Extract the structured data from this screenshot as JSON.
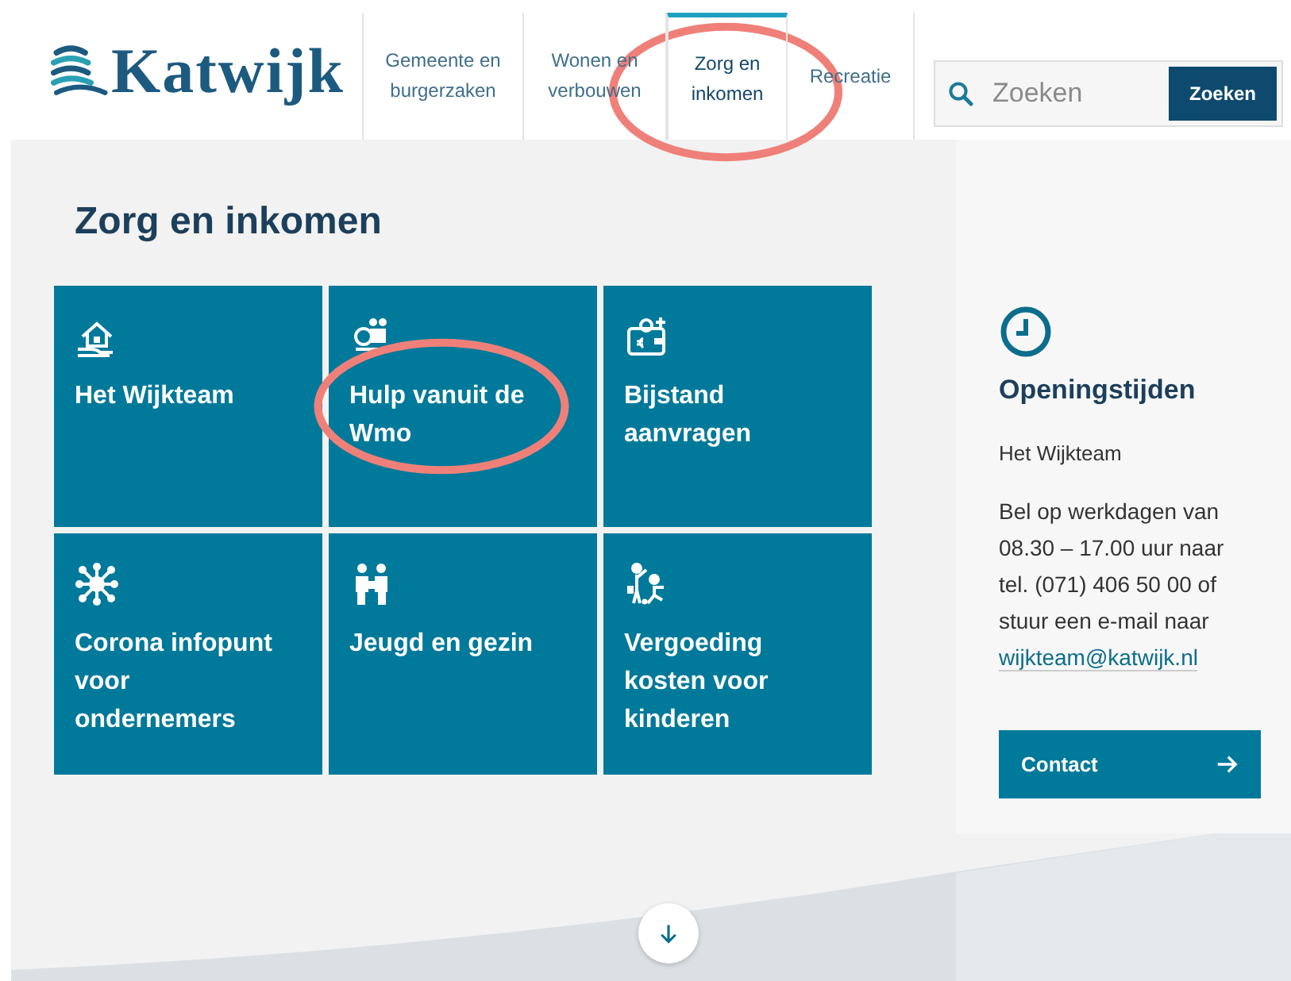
{
  "header": {
    "logo_text": "Katwijk",
    "nav": [
      {
        "label": "Gemeente en burgerzaken",
        "selected": false,
        "circled": false
      },
      {
        "label": "Wonen en verbouwen",
        "selected": false,
        "circled": false
      },
      {
        "label": "Zorg en inkomen",
        "selected": true,
        "circled": true
      },
      {
        "label": "Recreatie",
        "selected": false,
        "circled": false
      }
    ],
    "search": {
      "placeholder": "Zoeken",
      "button": "Zoeken"
    }
  },
  "main": {
    "title": "Zorg en inkomen",
    "tiles": [
      {
        "label": "Het Wijkteam",
        "circled": false
      },
      {
        "label": "Hulp vanuit de Wmo",
        "circled": true
      },
      {
        "label": "Bijstand aanvragen",
        "circled": false
      },
      {
        "label": "Corona infopunt voor ondernemers",
        "circled": false
      },
      {
        "label": "Jeugd en gezin",
        "circled": false
      },
      {
        "label": "Vergoeding kosten voor kinderen",
        "circled": false
      }
    ]
  },
  "sidebar": {
    "heading": "Openingstijden",
    "subheading": "Het Wijkteam",
    "body": "Bel op werkdagen van 08.30 – 17.00 uur naar tel. (071) 406 50 00 of stuur een e-mail naar",
    "email": "wijkteam@katwijk.nl",
    "button": "Contact"
  }
}
